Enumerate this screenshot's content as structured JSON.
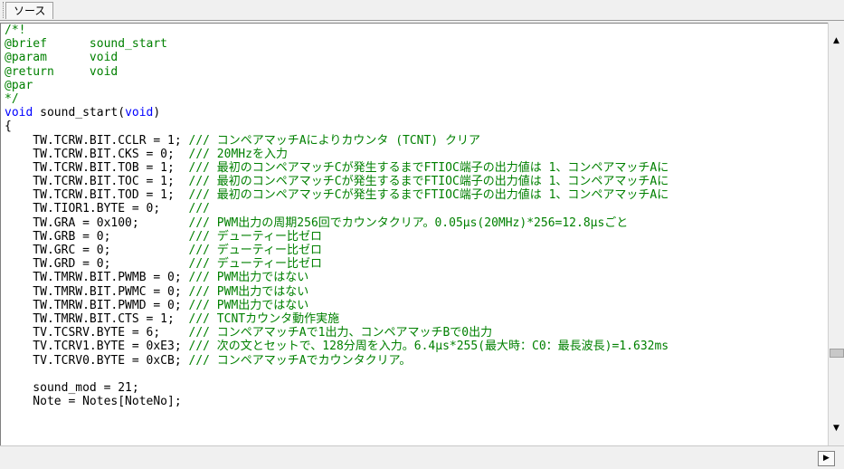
{
  "tab": {
    "label": "ソース"
  },
  "editor": {
    "lines": [
      {
        "parts": [
          {
            "t": "/*!",
            "c": "cmt"
          }
        ]
      },
      {
        "parts": [
          {
            "t": "@brief      sound_start",
            "c": "cmt"
          }
        ]
      },
      {
        "parts": [
          {
            "t": "@param      void",
            "c": "cmt"
          }
        ]
      },
      {
        "parts": [
          {
            "t": "@return     void",
            "c": "cmt"
          }
        ]
      },
      {
        "parts": [
          {
            "t": "@par",
            "c": "cmt"
          }
        ]
      },
      {
        "parts": [
          {
            "t": "*/",
            "c": "cmt"
          }
        ]
      },
      {
        "parts": [
          {
            "t": "void",
            "c": "kw"
          },
          {
            "t": " sound_start(",
            "c": "plain"
          },
          {
            "t": "void",
            "c": "kw"
          },
          {
            "t": ")",
            "c": "plain"
          }
        ]
      },
      {
        "parts": [
          {
            "t": "{",
            "c": "plain"
          }
        ]
      },
      {
        "parts": [
          {
            "t": "    TW.TCRW.BIT.CCLR = 1; ",
            "c": "plain"
          },
          {
            "t": "/// コンペアマッチAによりカウンタ (TCNT) クリア",
            "c": "cmt"
          }
        ]
      },
      {
        "parts": [
          {
            "t": "    TW.TCRW.BIT.CKS = 0;  ",
            "c": "plain"
          },
          {
            "t": "/// 20MHzを入力",
            "c": "cmt"
          }
        ]
      },
      {
        "parts": [
          {
            "t": "    TW.TCRW.BIT.TOB = 1;  ",
            "c": "plain"
          },
          {
            "t": "/// 最初のコンペアマッチCが発生するまでFTIOC端子の出力値は 1、コンペアマッチAに",
            "c": "cmt"
          }
        ]
      },
      {
        "parts": [
          {
            "t": "    TW.TCRW.BIT.TOC = 1;  ",
            "c": "plain"
          },
          {
            "t": "/// 最初のコンペアマッチCが発生するまでFTIOC端子の出力値は 1、コンペアマッチAに",
            "c": "cmt"
          }
        ]
      },
      {
        "parts": [
          {
            "t": "    TW.TCRW.BIT.TOD = 1;  ",
            "c": "plain"
          },
          {
            "t": "/// 最初のコンペアマッチCが発生するまでFTIOC端子の出力値は 1、コンペアマッチAに",
            "c": "cmt"
          }
        ]
      },
      {
        "parts": [
          {
            "t": "    TW.TIOR1.BYTE = 0;    ",
            "c": "plain"
          },
          {
            "t": "///",
            "c": "cmt"
          }
        ]
      },
      {
        "parts": [
          {
            "t": "    TW.GRA = 0x100;       ",
            "c": "plain"
          },
          {
            "t": "/// PWM出力の周期256回でカウンタクリア。0.05μs(20MHz)*256=12.8μsごと",
            "c": "cmt"
          }
        ]
      },
      {
        "parts": [
          {
            "t": "    TW.GRB = 0;           ",
            "c": "plain"
          },
          {
            "t": "/// デューティー比ゼロ",
            "c": "cmt"
          }
        ]
      },
      {
        "parts": [
          {
            "t": "    TW.GRC = 0;           ",
            "c": "plain"
          },
          {
            "t": "/// デューティー比ゼロ",
            "c": "cmt"
          }
        ]
      },
      {
        "parts": [
          {
            "t": "    TW.GRD = 0;           ",
            "c": "plain"
          },
          {
            "t": "/// デューティー比ゼロ",
            "c": "cmt"
          }
        ]
      },
      {
        "parts": [
          {
            "t": "    TW.TMRW.BIT.PWMB = 0; ",
            "c": "plain"
          },
          {
            "t": "/// PWM出力ではない",
            "c": "cmt"
          }
        ]
      },
      {
        "parts": [
          {
            "t": "    TW.TMRW.BIT.PWMC = 0; ",
            "c": "plain"
          },
          {
            "t": "/// PWM出力ではない",
            "c": "cmt"
          }
        ]
      },
      {
        "parts": [
          {
            "t": "    TW.TMRW.BIT.PWMD = 0; ",
            "c": "plain"
          },
          {
            "t": "/// PWM出力ではない",
            "c": "cmt"
          }
        ]
      },
      {
        "parts": [
          {
            "t": "    TW.TMRW.BIT.CTS = 1;  ",
            "c": "plain"
          },
          {
            "t": "/// TCNTカウンタ動作実施",
            "c": "cmt"
          }
        ]
      },
      {
        "parts": [
          {
            "t": "    TV.TCSRV.BYTE = 6;    ",
            "c": "plain"
          },
          {
            "t": "/// コンペアマッチAで1出力、コンペアマッチBで0出力",
            "c": "cmt"
          }
        ]
      },
      {
        "parts": [
          {
            "t": "    TV.TCRV1.BYTE = 0xE3; ",
            "c": "plain"
          },
          {
            "t": "/// 次の文とセットで、128分周を入力。6.4μs*255(最大時：C0：最長波長)=1.632ms",
            "c": "cmt"
          }
        ]
      },
      {
        "parts": [
          {
            "t": "    TV.TCRV0.BYTE = 0xCB; ",
            "c": "plain"
          },
          {
            "t": "/// コンペアマッチAでカウンタクリア。",
            "c": "cmt"
          }
        ]
      },
      {
        "parts": [
          {
            "t": "",
            "c": "plain"
          }
        ]
      },
      {
        "parts": [
          {
            "t": "    sound_mod = 21;",
            "c": "plain"
          }
        ]
      },
      {
        "parts": [
          {
            "t": "    Note = Notes[NoteNo];",
            "c": "plain"
          }
        ]
      }
    ]
  },
  "colors": {
    "comment": "#008000",
    "keyword": "#0000ff",
    "text": "#000000",
    "background": "#ffffff"
  },
  "icons": {
    "scroll_up": "triangle-up-icon",
    "scroll_down": "triangle-down-icon",
    "scroll_right": "triangle-right-icon"
  }
}
